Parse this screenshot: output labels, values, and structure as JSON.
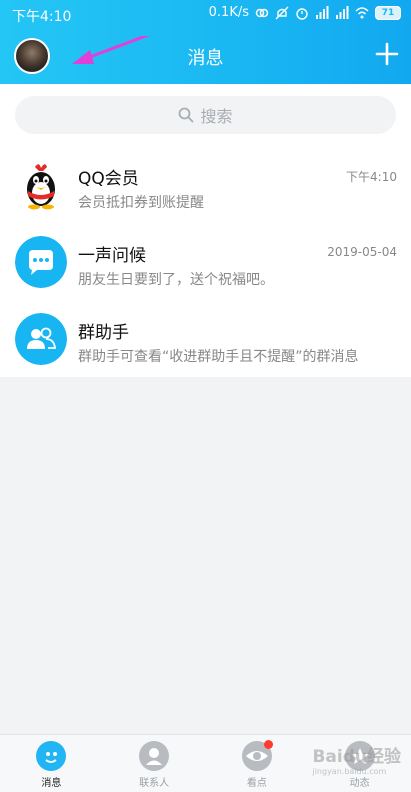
{
  "status_bar": {
    "time": "下午4:10",
    "net_speed": "0.1K/s",
    "battery": "71"
  },
  "header": {
    "title": "消息"
  },
  "search": {
    "placeholder": "搜索"
  },
  "conversations": [
    {
      "name": "QQ会员",
      "message": "会员抵扣券到账提醒",
      "time": "下午4:10",
      "icon": "qq-penguin-icon"
    },
    {
      "name": "一声问候",
      "message": "朋友生日要到了，送个祝福吧。",
      "time": "2019-05-04",
      "icon": "chat-bubble-icon"
    },
    {
      "name": "群助手",
      "message": "群助手可查看“收进群助手且不提醒”的群消息",
      "time": "",
      "icon": "group-icon"
    }
  ],
  "tabs": [
    {
      "label": "消息",
      "active": true
    },
    {
      "label": "联系人",
      "active": false
    },
    {
      "label": "看点",
      "active": false,
      "badge": true
    },
    {
      "label": "动态",
      "active": false
    }
  ],
  "watermark": {
    "brand": "Baidu经验",
    "url": "jingyan.baidu.com"
  },
  "colors": {
    "accent": "#1ab8f3",
    "badge": "#ff3b30",
    "annotation_arrow": "#e23fd8"
  }
}
